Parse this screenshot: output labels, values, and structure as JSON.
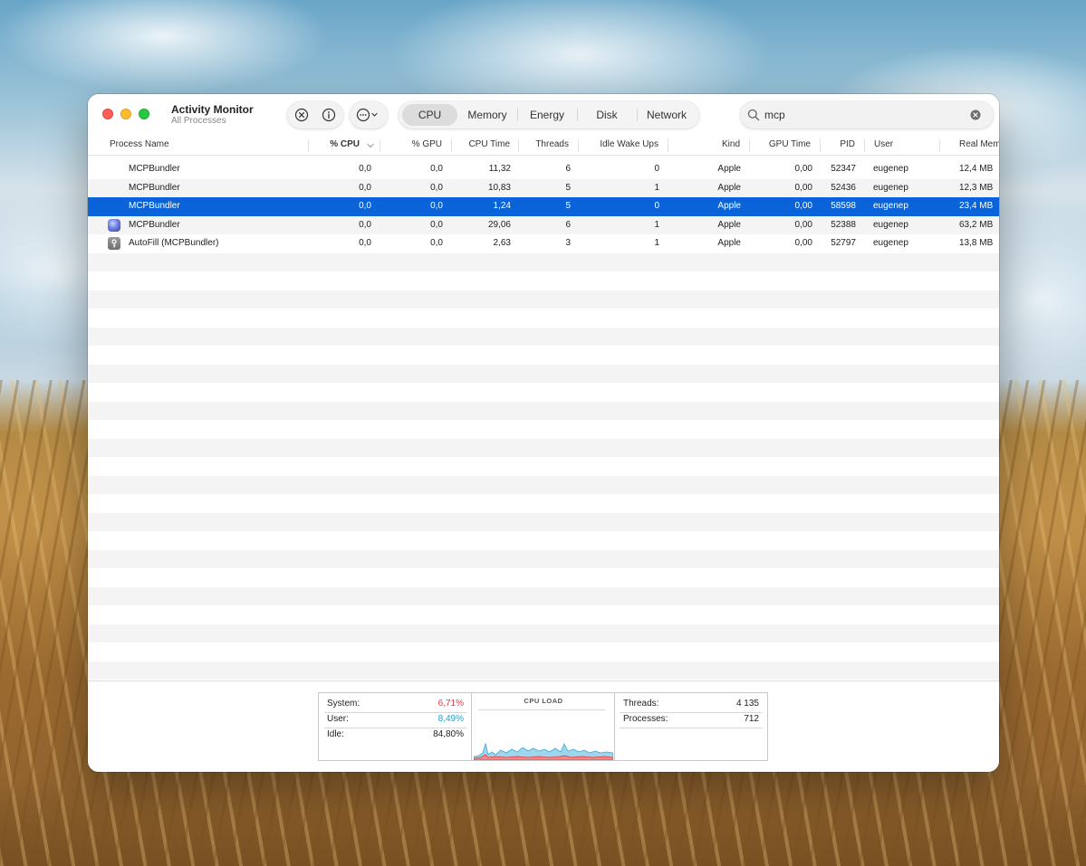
{
  "app": {
    "title": "Activity Monitor",
    "subtitle": "All Processes"
  },
  "toolbar": {
    "stop_icon": "xmark-circle-icon",
    "info_icon": "info-circle-icon",
    "more_icon": "ellipsis-circle-icon",
    "tabs": [
      {
        "label": "CPU",
        "active": true
      },
      {
        "label": "Memory",
        "active": false
      },
      {
        "label": "Energy",
        "active": false
      },
      {
        "label": "Disk",
        "active": false
      },
      {
        "label": "Network",
        "active": false
      }
    ]
  },
  "search": {
    "value": "mcp",
    "placeholder": "Search"
  },
  "table": {
    "columns": [
      "Process Name",
      "% CPU",
      "% GPU",
      "CPU Time",
      "Threads",
      "Idle Wake Ups",
      "Kind",
      "GPU Time",
      "PID",
      "User",
      "Real Mem"
    ],
    "rows": [
      {
        "name": "MCPBundler",
        "cpu": "0,0",
        "gpu": "0,0",
        "cpu_time": "11,32",
        "threads": "6",
        "idle": "0",
        "kind": "Apple",
        "gpu_time": "0,00",
        "pid": "52347",
        "user": "eugenep",
        "mem": "12,4 MB",
        "icon": "none",
        "selected": false
      },
      {
        "name": "MCPBundler",
        "cpu": "0,0",
        "gpu": "0,0",
        "cpu_time": "10,83",
        "threads": "5",
        "idle": "1",
        "kind": "Apple",
        "gpu_time": "0,00",
        "pid": "52436",
        "user": "eugenep",
        "mem": "12,3 MB",
        "icon": "none",
        "selected": false
      },
      {
        "name": "MCPBundler",
        "cpu": "0,0",
        "gpu": "0,0",
        "cpu_time": "1,24",
        "threads": "5",
        "idle": "0",
        "kind": "Apple",
        "gpu_time": "0,00",
        "pid": "58598",
        "user": "eugenep",
        "mem": "23,4 MB",
        "icon": "none",
        "selected": true
      },
      {
        "name": "MCPBundler",
        "cpu": "0,0",
        "gpu": "0,0",
        "cpu_time": "29,06",
        "threads": "6",
        "idle": "1",
        "kind": "Apple",
        "gpu_time": "0,00",
        "pid": "52388",
        "user": "eugenep",
        "mem": "63,2 MB",
        "icon": "app-icon",
        "selected": false
      },
      {
        "name": "AutoFill (MCPBundler)",
        "cpu": "0,0",
        "gpu": "0,0",
        "cpu_time": "2,63",
        "threads": "3",
        "idle": "1",
        "kind": "Apple",
        "gpu_time": "0,00",
        "pid": "52797",
        "user": "eugenep",
        "mem": "13,8 MB",
        "icon": "autofill-icon",
        "selected": false
      }
    ]
  },
  "stats": {
    "system_label": "System:",
    "system_value": "6,71%",
    "system_color": "#e0383e",
    "user_label": "User:",
    "user_value": "8,49%",
    "user_color": "#1aa3d4",
    "idle_label": "Idle:",
    "idle_value": "84,80%",
    "cpu_load_title": "CPU LOAD",
    "threads_label": "Threads:",
    "threads_value": "4 135",
    "processes_label": "Processes:",
    "processes_value": "712"
  },
  "colors": {
    "selection": "#0a63d8",
    "accent": "#0a63d8"
  }
}
